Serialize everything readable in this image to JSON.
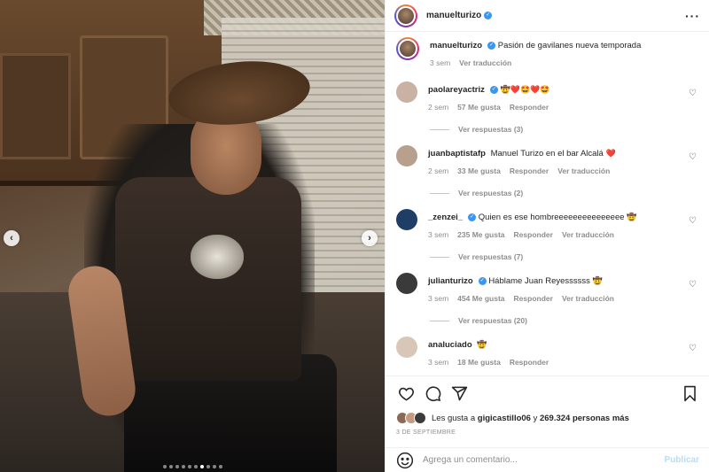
{
  "post": {
    "username": "manuelturizo",
    "caption": "Pasión de gavilanes nueva temporada",
    "caption_time": "3 sem",
    "see_translation": "Ver traducción",
    "carousel_dots": 10,
    "active_dot": 6
  },
  "comments": [
    {
      "user": "paolareyactriz",
      "verified": true,
      "text": "",
      "emoji": "🤠❤️🤩❤️🤩",
      "time": "2 sem",
      "likes": "57 Me gusta",
      "reply": "Responder",
      "translate": "",
      "replies": "Ver respuestas (3)",
      "avatar_color": "#c9b1a3"
    },
    {
      "user": "juanbaptistafp",
      "verified": false,
      "text": "Manuel Turizo en el bar Alcalá",
      "emoji": "❤️",
      "time": "2 sem",
      "likes": "33 Me gusta",
      "reply": "Responder",
      "translate": "Ver traducción",
      "replies": "Ver respuestas (2)",
      "avatar_color": "#b7a08d"
    },
    {
      "user": "_zenzei_",
      "verified": true,
      "text": "Quien es ese hombreeeeeeeeeeeeeee",
      "emoji": "🤠",
      "time": "3 sem",
      "likes": "235 Me gusta",
      "reply": "Responder",
      "translate": "Ver traducción",
      "replies": "Ver respuestas (7)",
      "avatar_color": "#1f3e66"
    },
    {
      "user": "julianturizo",
      "verified": true,
      "text": "Háblame Juan Reyessssss",
      "emoji": "🤠",
      "time": "3 sem",
      "likes": "454 Me gusta",
      "reply": "Responder",
      "translate": "Ver traducción",
      "replies": "Ver respuestas (20)",
      "avatar_color": "#3a3a3a"
    },
    {
      "user": "analuciado",
      "verified": false,
      "text": "",
      "emoji": "🤠",
      "time": "3 sem",
      "likes": "18 Me gusta",
      "reply": "Responder",
      "translate": "",
      "replies": "",
      "avatar_color": "#d8c7b8"
    }
  ],
  "likes": {
    "prefix": "Les gusta a",
    "user": "gigicastillo06",
    "connector": "y",
    "count": "269.324 personas más"
  },
  "date": "3 DE SEPTIEMBRE",
  "add_comment": {
    "placeholder": "Agrega un comentario...",
    "publish": "Publicar"
  },
  "icons": {
    "like": "heart-icon",
    "comment": "comment-icon",
    "share": "share-icon",
    "save": "bookmark-icon",
    "emoji": "smile-icon",
    "more": "more-icon"
  },
  "colors": {
    "verified": "#3897f0",
    "muted": "#8e8e8e",
    "publish": "#b2dffc",
    "heart_red": "#ed4956"
  }
}
